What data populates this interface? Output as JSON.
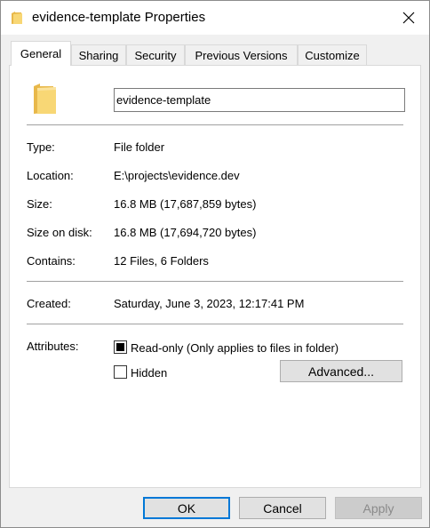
{
  "window": {
    "title": "evidence-template Properties"
  },
  "tabs": [
    {
      "label": "General",
      "active": true
    },
    {
      "label": "Sharing",
      "active": false
    },
    {
      "label": "Security",
      "active": false
    },
    {
      "label": "Previous Versions",
      "active": false
    },
    {
      "label": "Customize",
      "active": false
    }
  ],
  "general": {
    "name_value": "evidence-template",
    "type": {
      "label": "Type:",
      "value": "File folder"
    },
    "location": {
      "label": "Location:",
      "value": "E:\\projects\\evidence.dev"
    },
    "size": {
      "label": "Size:",
      "value": "16.8 MB (17,687,859 bytes)"
    },
    "size_on_disk": {
      "label": "Size on disk:",
      "value": "16.8 MB (17,694,720 bytes)"
    },
    "contains": {
      "label": "Contains:",
      "value": "12 Files, 6 Folders"
    },
    "created": {
      "label": "Created:",
      "value": "Saturday, June 3, 2023, 12:17:41 PM"
    },
    "attributes": {
      "label": "Attributes:",
      "readonly_label": "Read-only (Only applies to files in folder)",
      "readonly_state": "indeterminate",
      "hidden_label": "Hidden",
      "hidden_state": "unchecked",
      "advanced_label": "Advanced..."
    }
  },
  "buttons": {
    "ok": "OK",
    "cancel": "Cancel",
    "apply": "Apply"
  },
  "colors": {
    "folder_yellow": "#f8d775",
    "accent_blue": "#0078d7"
  },
  "icons": {
    "title": "folder-icon",
    "close": "close-icon",
    "folder_large": "folder-icon"
  }
}
